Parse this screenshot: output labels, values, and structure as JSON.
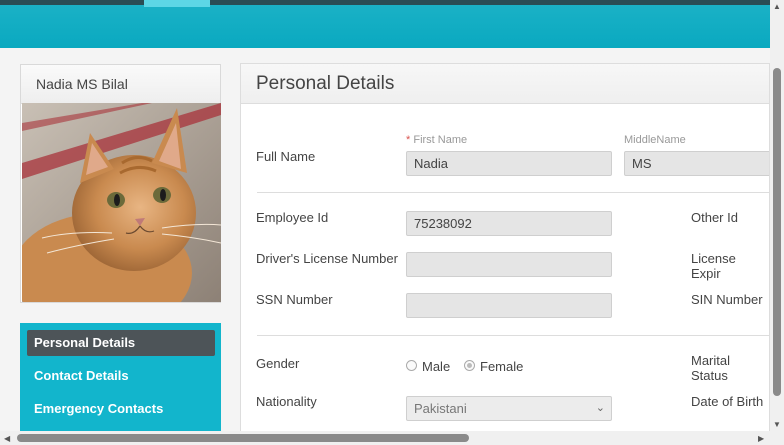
{
  "profile": {
    "name": "Nadia MS Bilal"
  },
  "nav": {
    "items": [
      {
        "label": "Personal Details",
        "active": true
      },
      {
        "label": "Contact Details",
        "active": false
      },
      {
        "label": "Emergency Contacts",
        "active": false
      }
    ]
  },
  "panel": {
    "title": "Personal Details",
    "full_name_label": "Full Name",
    "required_mark": "*",
    "first_name_label": "First Name",
    "first_name_value": "Nadia",
    "middle_name_label": "MiddleName",
    "middle_name_value": "MS",
    "employee_id_label": "Employee Id",
    "employee_id_value": "75238092",
    "other_id_label": "Other Id",
    "drivers_license_label": "Driver's License Number",
    "drivers_license_value": "",
    "license_expiry_label": "License Expir",
    "ssn_label": "SSN Number",
    "ssn_value": "",
    "sin_label": "SIN Number",
    "gender_label": "Gender",
    "gender_options": {
      "male": "Male",
      "female": "Female"
    },
    "gender_selected": "Female",
    "marital_status_label": "Marital Status",
    "nationality_label": "Nationality",
    "nationality_value": "Pakistani",
    "dob_label": "Date of Birth"
  }
}
